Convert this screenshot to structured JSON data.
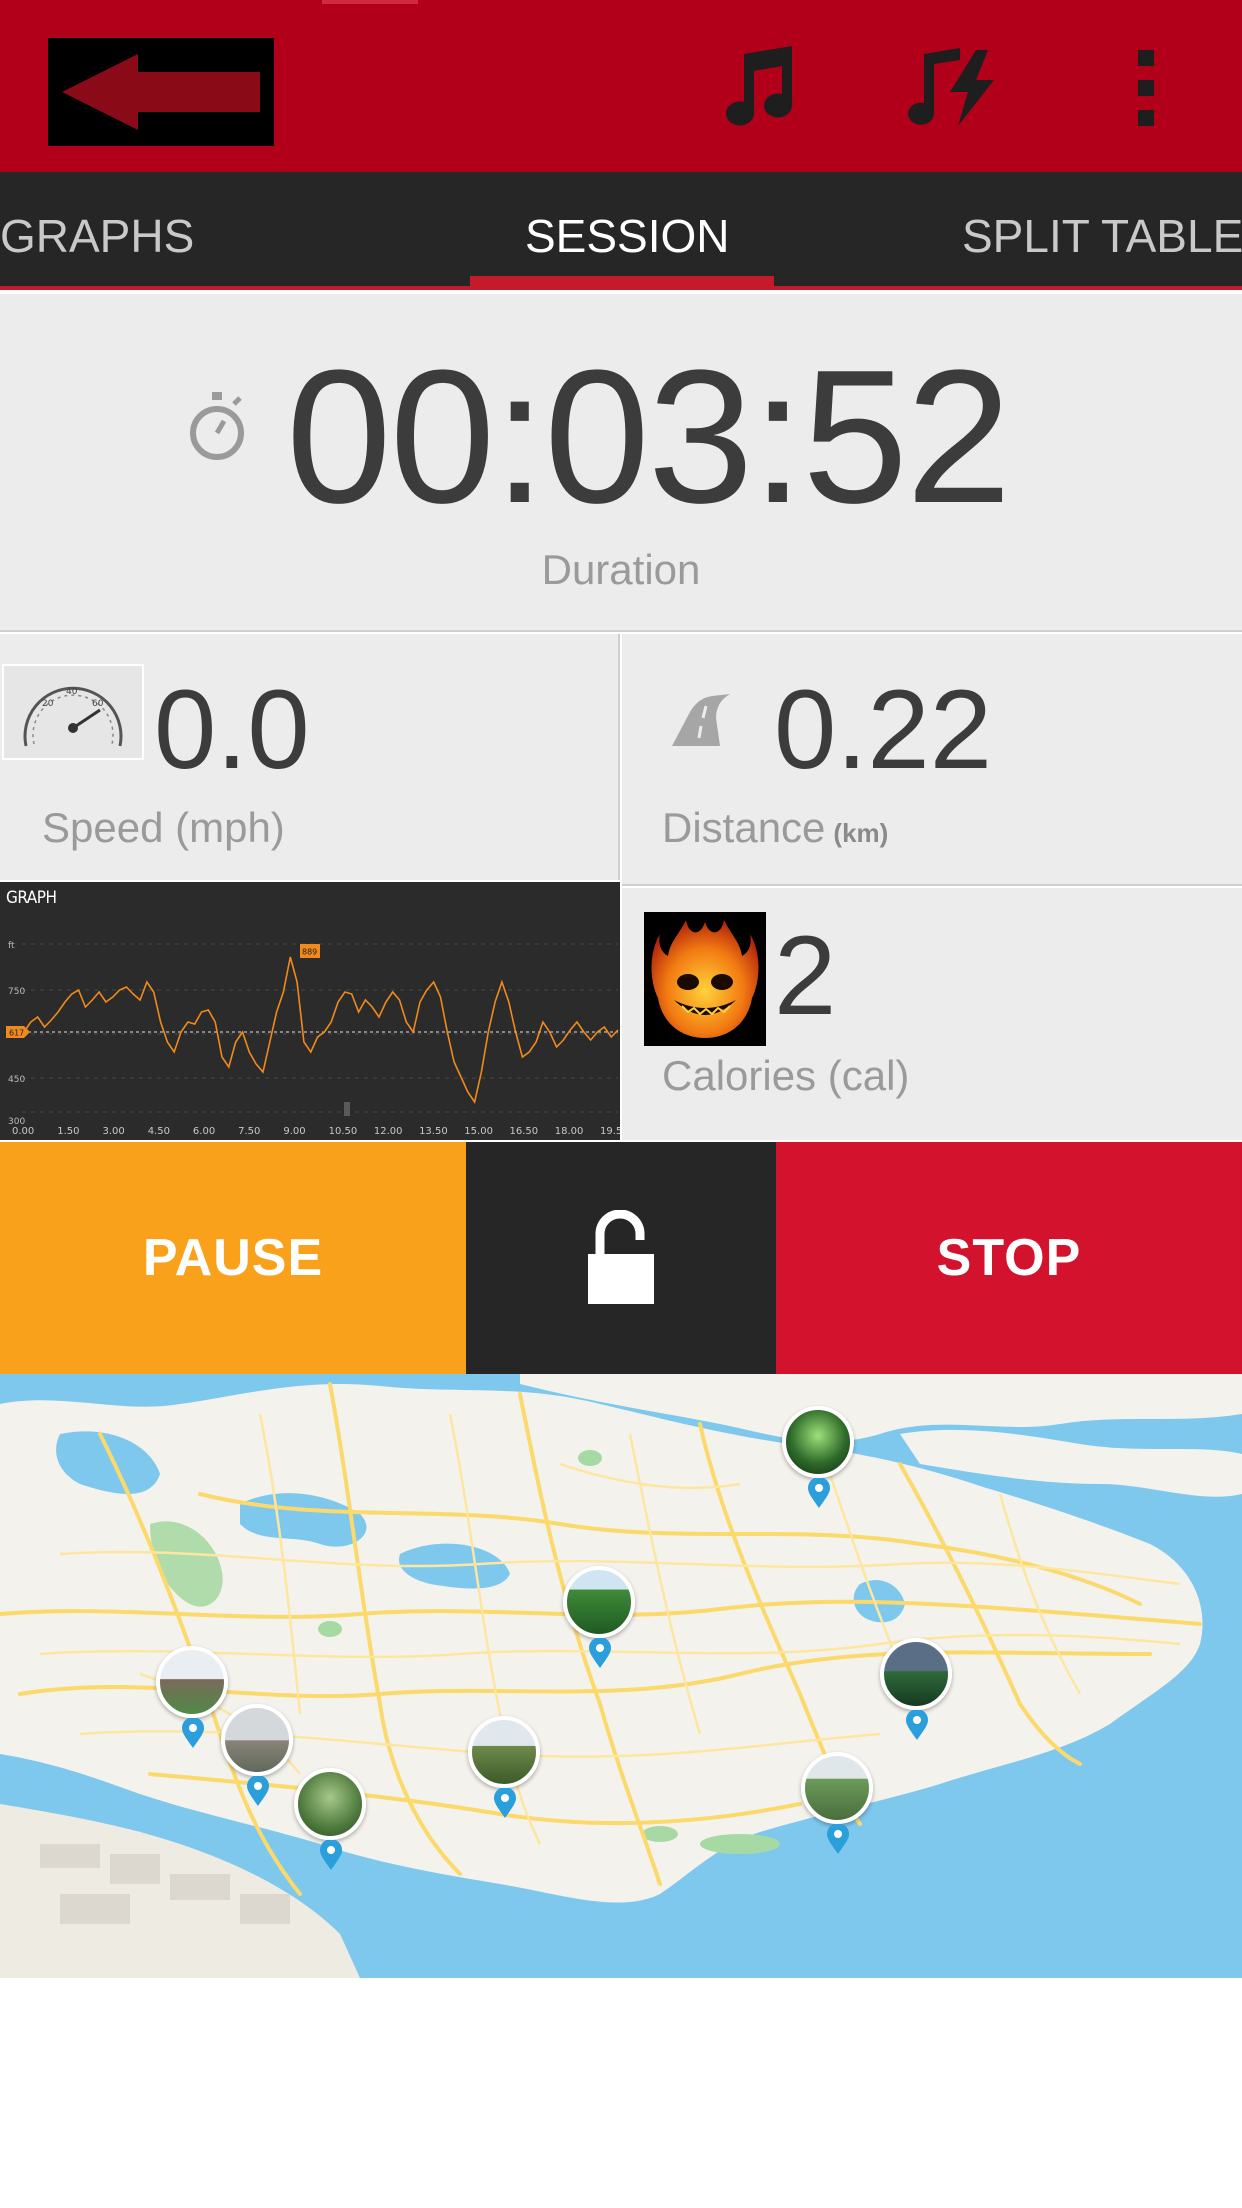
{
  "app_bar": {
    "back_icon": "back-arrow-icon",
    "music_icon": "music-note-icon",
    "power_song_icon": "power-song-icon",
    "overflow_icon": "overflow-menu-icon",
    "color": "#b2001b"
  },
  "tabs": [
    {
      "label": "GRAPHS",
      "active": false
    },
    {
      "label": "SESSION",
      "active": true
    },
    {
      "label": "SPLIT TABLE",
      "active": false
    }
  ],
  "session": {
    "duration": {
      "value": "00:03:52",
      "label": "Duration",
      "icon": "stopwatch-icon"
    },
    "speed": {
      "value": "0.0",
      "label": "Speed (mph)",
      "icon": "speedometer-icon"
    },
    "distance": {
      "value": "0.22",
      "label": "Distance",
      "unit": "(km)",
      "icon": "road-icon"
    },
    "calories": {
      "value": "2",
      "label": "Calories (cal)",
      "icon": "flame-face-logo"
    }
  },
  "graph": {
    "title": "GRAPH",
    "y_axis_label": "ft",
    "y_ticks": [
      "750",
      "450",
      "300"
    ],
    "x_ticks": [
      "0.00",
      "1.50",
      "3.00",
      "4.50",
      "6.00",
      "7.50",
      "9.00",
      "10.50",
      "12.00",
      "13.50",
      "15.00",
      "16.50",
      "18.00",
      "19.5"
    ],
    "max_marker": "889",
    "avg_marker": "617",
    "line_color": "#f08a1c"
  },
  "controls": {
    "pause_label": "PAUSE",
    "stop_label": "STOP",
    "lock_icon": "unlock-icon",
    "pause_color": "#f9a11b",
    "stop_color": "#d3122e"
  },
  "map": {
    "pins": [
      {
        "name": "photo-pin-1"
      },
      {
        "name": "photo-pin-2"
      },
      {
        "name": "photo-pin-3"
      },
      {
        "name": "photo-pin-4"
      },
      {
        "name": "photo-pin-5"
      },
      {
        "name": "photo-pin-6"
      },
      {
        "name": "photo-pin-7"
      },
      {
        "name": "photo-pin-8"
      }
    ],
    "water_color": "#7ec8ee",
    "land_color": "#f4f2ec",
    "road_color": "#fbd96b"
  }
}
